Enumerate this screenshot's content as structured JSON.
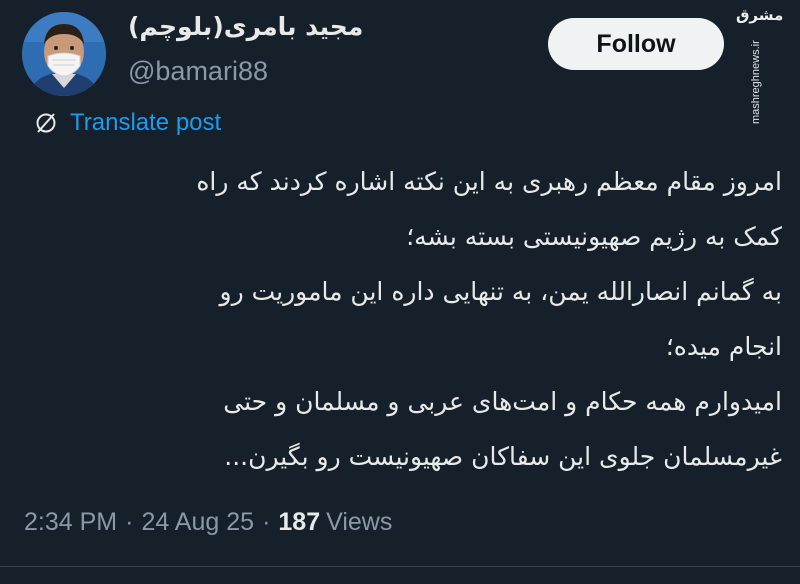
{
  "author": {
    "display_name": "مجید بامری(بلوچم)",
    "handle": "@bamari88"
  },
  "follow_label": "Follow",
  "translate_label": "Translate post",
  "tweet_lines": [
    "امروز مقام معظم رهبری به این نکته اشاره کردند که راه",
    "کمک به رژیم صهیونیستی بسته بشه؛",
    "به گمانم انصارالله یمن، به تنهایی داره این ماموریت رو",
    "انجام میده؛",
    "امیدوارم همه حکام و امت‌های عربی و مسلمان و حتی",
    "غیرمسلمان جلوی این سفاکان صهیونیست رو بگیرن..."
  ],
  "meta": {
    "time": "2:34 PM",
    "separator": "·",
    "date": "24 Aug 25",
    "views_count": "187",
    "views_label": "Views"
  },
  "watermark": {
    "logo_text": "مشرق",
    "url_text": "mashreghnews.ir"
  },
  "icons": {
    "translate": "translate-globe-icon"
  },
  "colors": {
    "background": "#15202b",
    "text_primary": "#e7e9ea",
    "text_secondary": "#8b98a5",
    "link": "#1d9bf0",
    "follow_bg": "#eff3f4"
  }
}
